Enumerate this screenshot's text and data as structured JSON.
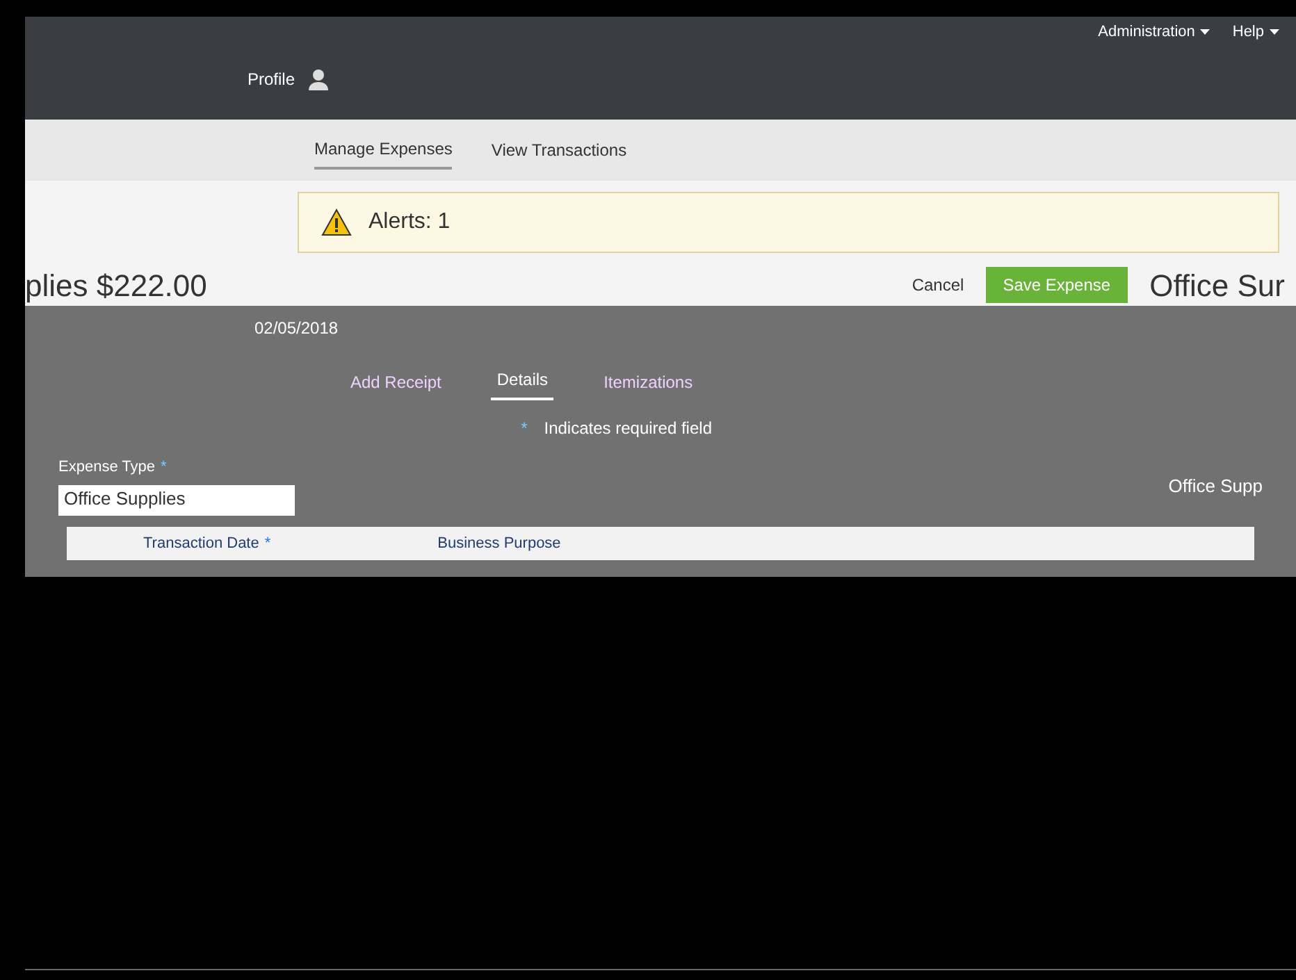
{
  "top_bar": {
    "menus": [
      {
        "label": "Administration"
      },
      {
        "label": "Help"
      }
    ],
    "profile": "Profile"
  },
  "nav_tabs": [
    {
      "label": "Manage Expenses",
      "selected": true
    },
    {
      "label": "View Transactions",
      "selected": false
    }
  ],
  "alerts": {
    "label": "Alerts: 1"
  },
  "expense": {
    "title": "plies $222.00",
    "date": "02/05/2018",
    "cancel": "Cancel",
    "save": "Save Expense",
    "side_title": "Office Sur"
  },
  "sub_tabs": [
    {
      "label": "Add Receipt",
      "selected": false
    },
    {
      "label": "Details",
      "selected": true
    },
    {
      "label": "Itemizations",
      "selected": false
    }
  ],
  "required_mark": "*",
  "required_note": "Indicates required field",
  "form": {
    "expense_type_label": "Expense Type",
    "expense_type_mark": "*",
    "transaction_date_mark": "*",
    "expense_type_value": "Office Supplies",
    "side_value": "Office Supp",
    "transaction_date_label": "Transaction Date",
    "business_purpose_label": "Business Purpose"
  }
}
